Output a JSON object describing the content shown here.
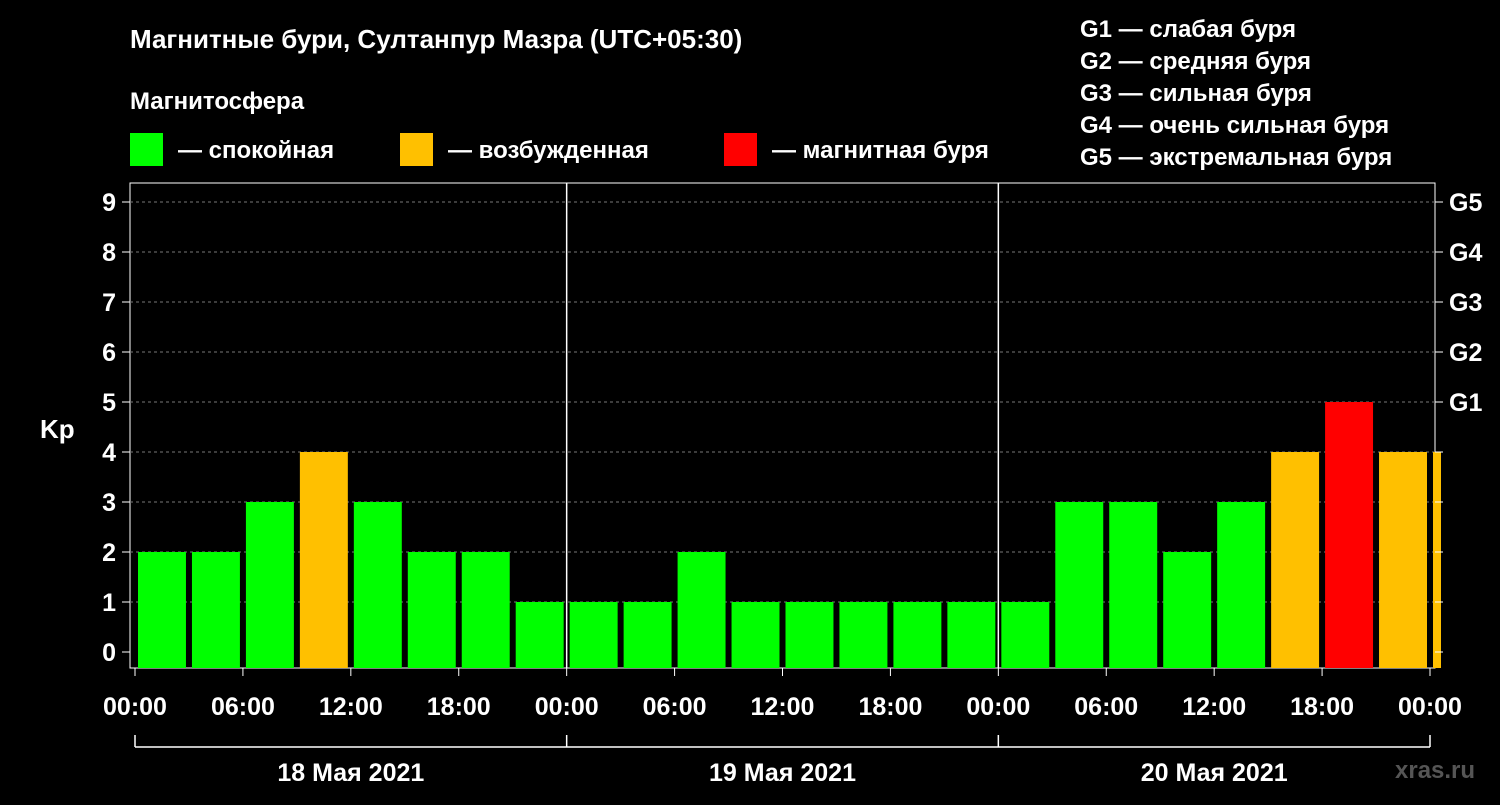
{
  "chart_data": {
    "type": "bar",
    "title": "Магнитные бури, Султанпур Мазра (UTC+05:30)",
    "subtitle": "Магнитосфера",
    "ylabel": "Kp",
    "ylim": [
      0,
      9
    ],
    "yticks": [
      "0",
      "1",
      "2",
      "3",
      "4",
      "5",
      "6",
      "7",
      "8",
      "9"
    ],
    "right_ticks": [
      {
        "value": 5,
        "label": "G1"
      },
      {
        "value": 6,
        "label": "G2"
      },
      {
        "value": 7,
        "label": "G3"
      },
      {
        "value": 8,
        "label": "G4"
      },
      {
        "value": 9,
        "label": "G5"
      }
    ],
    "x_tick_labels": [
      "00:00",
      "06:00",
      "12:00",
      "18:00",
      "00:00",
      "06:00",
      "12:00",
      "18:00",
      "00:00",
      "06:00",
      "12:00",
      "18:00",
      "00:00"
    ],
    "dates": [
      "18 Мая 2021",
      "19 Мая 2021",
      "20 Мая 2021"
    ],
    "x_hours": [
      0,
      3,
      6,
      9,
      12,
      15,
      18,
      21,
      24,
      27,
      30,
      33,
      36,
      39,
      42,
      45,
      48,
      51,
      54,
      57,
      60,
      63,
      66,
      69
    ],
    "values": [
      2,
      2,
      3,
      4,
      3,
      2,
      2,
      1,
      1,
      1,
      2,
      1,
      1,
      1,
      1,
      1,
      1,
      3,
      3,
      2,
      3,
      4,
      5,
      4,
      4
    ],
    "status": [
      "quiet",
      "quiet",
      "quiet",
      "active",
      "quiet",
      "quiet",
      "quiet",
      "quiet",
      "quiet",
      "quiet",
      "quiet",
      "quiet",
      "quiet",
      "quiet",
      "quiet",
      "quiet",
      "quiet",
      "quiet",
      "quiet",
      "quiet",
      "quiet",
      "active",
      "storm",
      "active",
      "active"
    ],
    "colors": {
      "quiet": "#00ff00",
      "active": "#ffc000",
      "storm": "#ff0000"
    },
    "legend": [
      {
        "key": "quiet",
        "label": "— спокойная"
      },
      {
        "key": "active",
        "label": "— возбужденная"
      },
      {
        "key": "storm",
        "label": "— магнитная буря"
      }
    ],
    "g_scale": [
      "G1 — слабая буря",
      "G2 — средняя буря",
      "G3 — сильная буря",
      "G4 — очень сильная буря",
      "G5 — экстремальная буря"
    ],
    "grid": true
  },
  "watermark": "xras.ru"
}
